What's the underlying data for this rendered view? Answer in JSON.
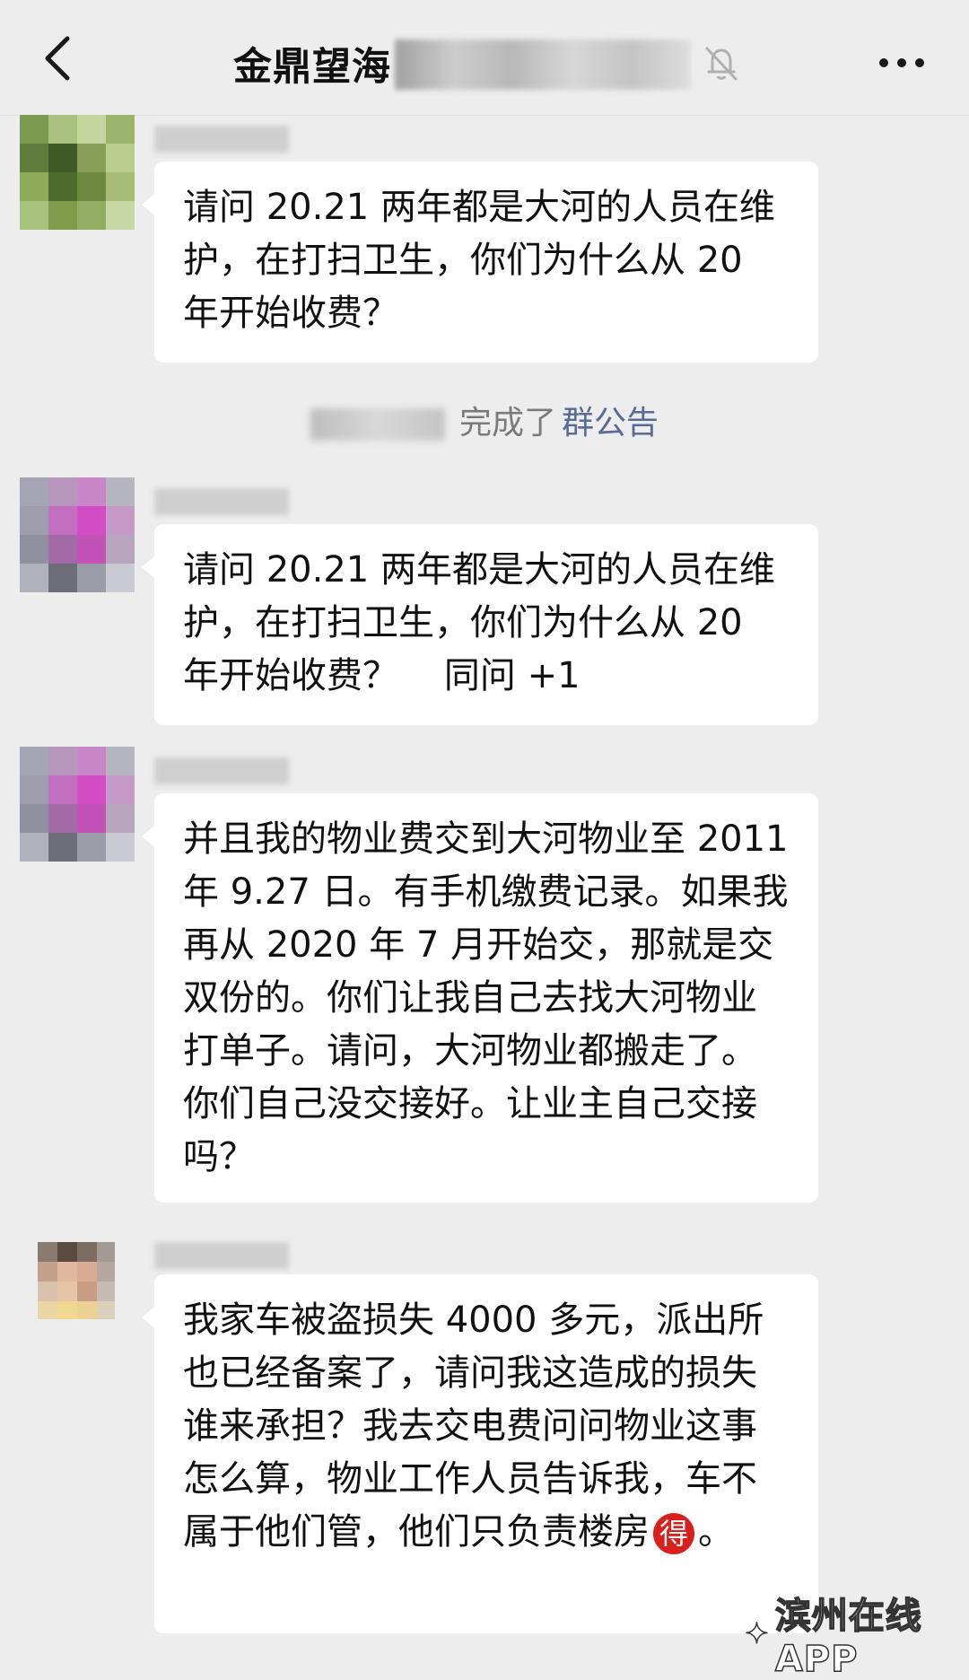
{
  "header": {
    "back_icon": "chevron-left-icon",
    "title": "金鼎望海",
    "mute_icon": "bell-off-icon",
    "more_icon": "more-dots-icon"
  },
  "messages": [
    {
      "text": "请问 20.21 两年都是大河的人员在维护，在打扫卫生，你们为什么从 20 年开始收费？"
    },
    {
      "text": "请问 20.21 两年都是大河的人员在维护，在打扫卫生，你们为什么从 20 年开始收费？    同问 +1"
    },
    {
      "text": "并且我的物业费交到大河物业至 2011 年 9.27 日。有手机缴费记录。如果我再从 2020 年 7 月开始交，那就是交双份的。你们让我自己去找大河物业打单子。请问，大河物业都搬走了。你们自己没交接好。让业主自己交接吗？"
    },
    {
      "text": "我家车被盗损失 4000 多元，派出所也已经备案了，请问我这造成的损失谁来承担？我去交电费问问物业这事怎么算，物业工作人员告诉我，车不属于他们管，他们只负责楼房",
      "emoji_char": "得",
      "tail": "。"
    }
  ],
  "system_notice": {
    "text": "完成了",
    "link": "群公告"
  },
  "watermark": {
    "text": "滨州在线APP"
  },
  "colors": {
    "background": "#ededed",
    "bubble": "#ffffff",
    "link": "#586b94",
    "system_text": "#7a7a7a"
  }
}
